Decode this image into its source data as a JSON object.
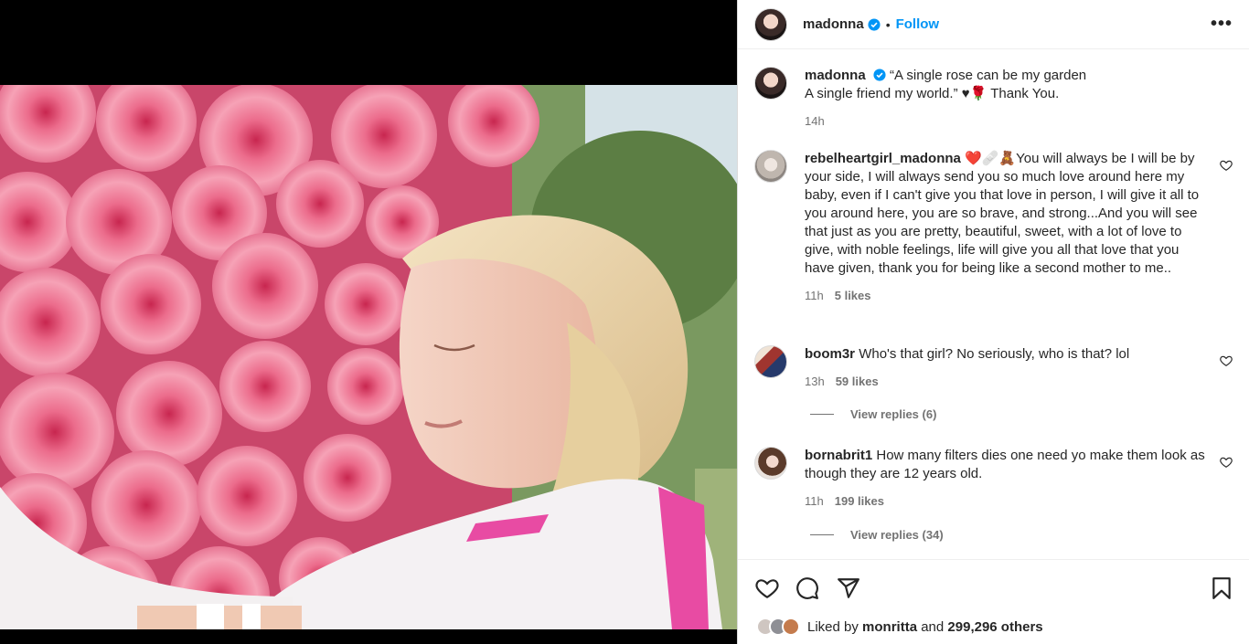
{
  "post": {
    "author": "madonna",
    "follow_label": "Follow",
    "dot": "•",
    "more_label": "•••"
  },
  "caption": {
    "author": "madonna",
    "line1": "“A single rose can be my garden",
    "line2": "A single friend my world.” ♥🌹 Thank You.",
    "time": "14h"
  },
  "comments": [
    {
      "user": "rebelheartgirl_madonna",
      "text": "❤️🩹🧸You will always be I will be by your side, I will always send you so much love around here my baby, even if I can't give you that love in person, I will give it all to you around here, you are so brave, and strong...And you will see that just as you are pretty, beautiful, sweet, with a lot of love to give, with noble feelings, life will give you all that love that you have given, thank you for being like a second mother to me..",
      "time": "11h",
      "likes": "5 likes"
    },
    {
      "user": "boom3r",
      "text": "Who's that girl? No seriously, who is that? lol",
      "time": "13h",
      "likes": "59 likes",
      "replies": "View replies (6)"
    },
    {
      "user": "bornabrit1",
      "text": "How many filters dies one need yo make them look as though they are 12 years old.",
      "time": "11h",
      "likes": "199 likes",
      "replies": "View replies (34)"
    }
  ],
  "likes_summary": {
    "prefix": "Liked by",
    "user": "monritta",
    "middle": "and",
    "count": "299,296 others"
  },
  "colors": {
    "accent": "#0095f6",
    "verified": "#0095f6",
    "text": "#262626",
    "muted": "#737373"
  },
  "icons": [
    "verified-badge-icon",
    "more-options-icon",
    "heart-icon",
    "comment-icon",
    "share-icon",
    "bookmark-icon"
  ]
}
